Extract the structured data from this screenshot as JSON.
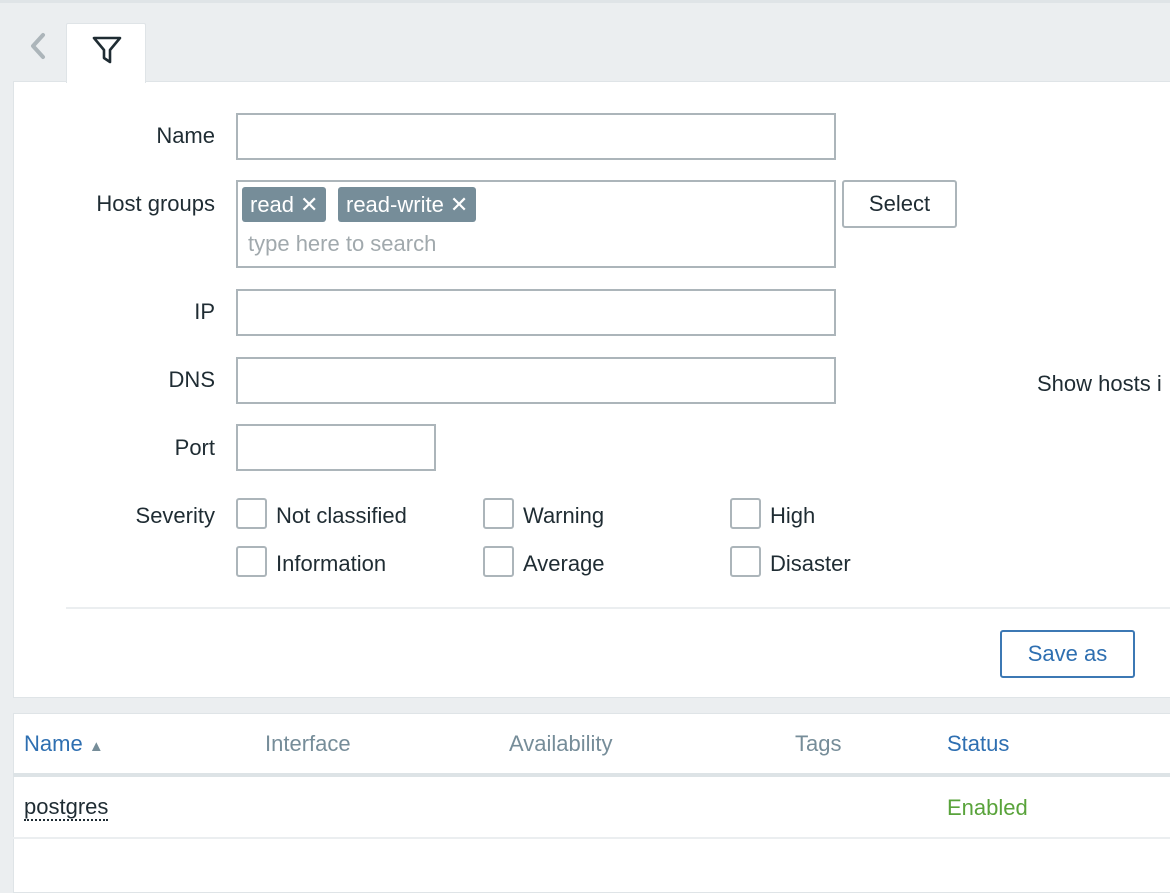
{
  "filter": {
    "tab_icon": "filter-icon",
    "back_icon": "chevron-left-icon",
    "fields": {
      "name": {
        "label": "Name",
        "value": ""
      },
      "host_groups": {
        "label": "Host groups",
        "chips": [
          "read",
          "read-write"
        ],
        "placeholder": "type here to search",
        "select_label": "Select"
      },
      "ip": {
        "label": "IP",
        "value": ""
      },
      "dns": {
        "label": "DNS",
        "value": ""
      },
      "port": {
        "label": "Port",
        "value": ""
      }
    },
    "severity": {
      "label": "Severity",
      "options": [
        {
          "label": "Not classified",
          "checked": false
        },
        {
          "label": "Warning",
          "checked": false
        },
        {
          "label": "High",
          "checked": false
        },
        {
          "label": "Information",
          "checked": false
        },
        {
          "label": "Average",
          "checked": false
        },
        {
          "label": "Disaster",
          "checked": false
        }
      ]
    },
    "show_hosts_label": "Show hosts i",
    "save_as_label": "Save as"
  },
  "table": {
    "columns": [
      {
        "label": "Name",
        "sortable": true,
        "sorted": "asc"
      },
      {
        "label": "Interface",
        "sortable": false
      },
      {
        "label": "Availability",
        "sortable": false
      },
      {
        "label": "Tags",
        "sortable": false
      },
      {
        "label": "Status",
        "sortable": true
      }
    ],
    "rows": [
      {
        "name": "postgres",
        "interface": "",
        "availability": "",
        "tags": "",
        "status": "Enabled"
      }
    ]
  },
  "colors": {
    "link": "#2e6fb1",
    "enabled": "#59a33b",
    "chip": "#768d99"
  }
}
